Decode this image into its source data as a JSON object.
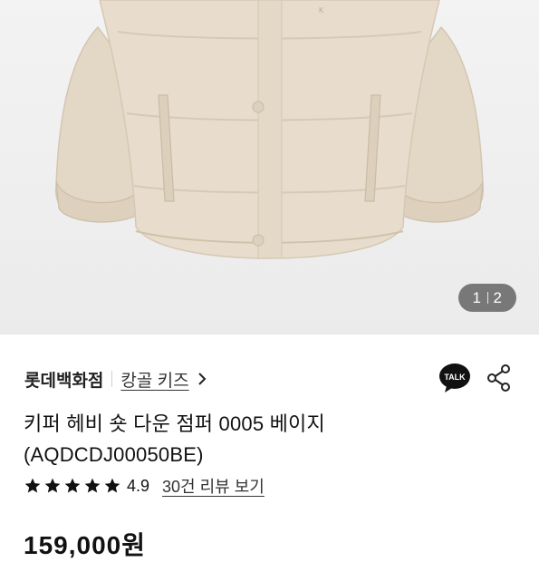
{
  "image": {
    "counter_current": "1",
    "counter_total": "2",
    "colors": {
      "jacket": "#e7dccb",
      "background": "#efefef"
    }
  },
  "store": {
    "name": "롯데백화점",
    "brand": "캉골 키즈",
    "chevron_icon": "chevron-right-icon"
  },
  "actions": {
    "talk_label": "TALK",
    "talk_icon": "kakaotalk-icon",
    "share_icon": "share-icon"
  },
  "product": {
    "title_line1": "키퍼 헤비 숏 다운 점퍼 0005 베이지",
    "title_line2": "(AQDCDJ00050BE)"
  },
  "rating": {
    "stars": 5,
    "score": "4.9",
    "reviews_link": "30건 리뷰 보기"
  },
  "price": {
    "amount": "159,000원"
  }
}
